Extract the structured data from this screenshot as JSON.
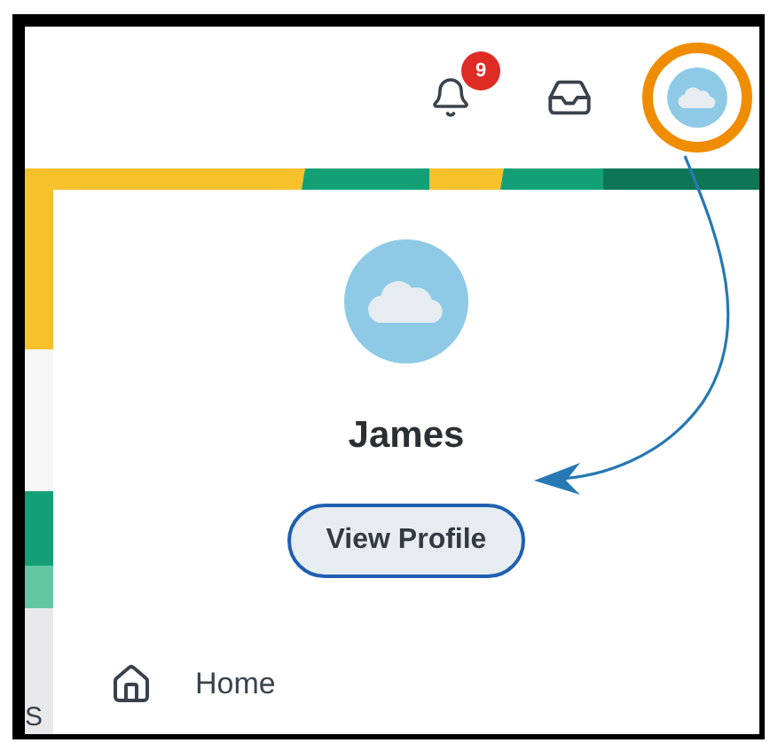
{
  "header": {
    "notifications": {
      "count": "9"
    }
  },
  "profile": {
    "name": "James",
    "button": "View Profile"
  },
  "menu": [
    {
      "label": "Home"
    }
  ],
  "side_text": "S"
}
